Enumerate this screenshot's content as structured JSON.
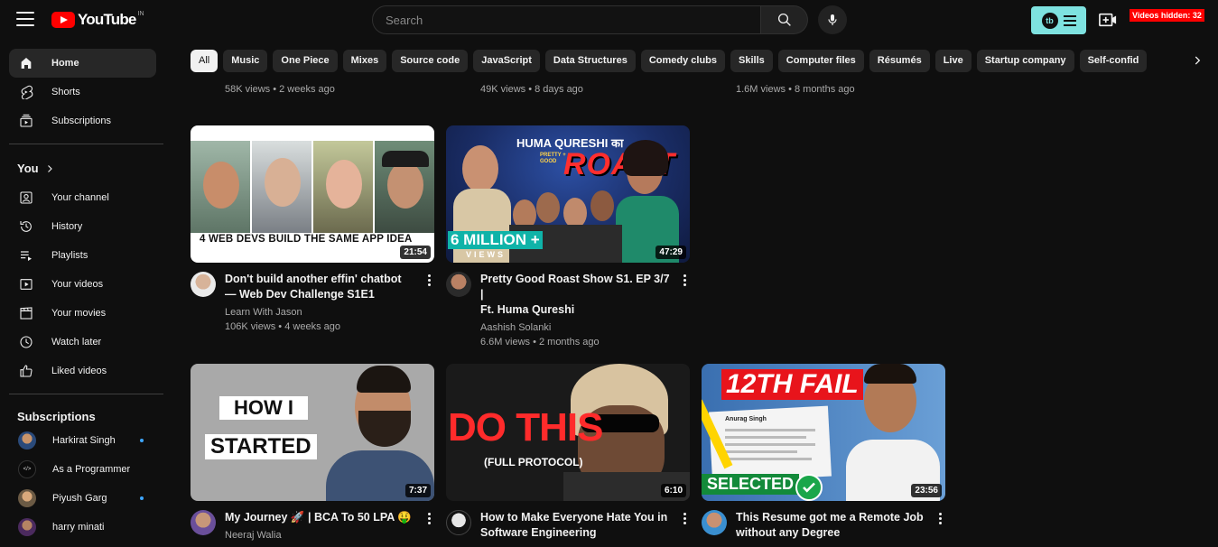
{
  "masthead": {
    "logo_text": "YouTube",
    "country": "IN",
    "search_placeholder": "Search",
    "hidden_badge": "Videos hidden: 32"
  },
  "sidebar": {
    "main": [
      {
        "label": "Home",
        "icon": "home-icon"
      },
      {
        "label": "Shorts",
        "icon": "shorts-icon"
      },
      {
        "label": "Subscriptions",
        "icon": "subscriptions-icon"
      }
    ],
    "you_heading": "You",
    "you": [
      {
        "label": "Your channel",
        "icon": "channel-icon"
      },
      {
        "label": "History",
        "icon": "history-icon"
      },
      {
        "label": "Playlists",
        "icon": "playlists-icon"
      },
      {
        "label": "Your videos",
        "icon": "your-videos-icon"
      },
      {
        "label": "Your movies",
        "icon": "movies-icon"
      },
      {
        "label": "Watch later",
        "icon": "watch-later-icon"
      },
      {
        "label": "Liked videos",
        "icon": "liked-icon"
      }
    ],
    "subs_heading": "Subscriptions",
    "subscriptions": [
      {
        "label": "Harkirat Singh",
        "new": true
      },
      {
        "label": "As a Programmer",
        "new": false
      },
      {
        "label": "Piyush Garg",
        "new": true
      },
      {
        "label": "harry minati",
        "new": false
      }
    ]
  },
  "chips": [
    "All",
    "Music",
    "One Piece",
    "Mixes",
    "Source code",
    "JavaScript",
    "Data Structures",
    "Comedy clubs",
    "Skills",
    "Computer files",
    "Résumés",
    "Live",
    "Startup company",
    "Self-confid"
  ],
  "prev_row": [
    "58K views • 2 weeks ago",
    "49K views • 8 days ago",
    "1.6M views • 8 months ago"
  ],
  "videos": [
    {
      "title_l1": "Don't build another effin' chatbot",
      "title_l2": "— Web Dev Challenge S1E1",
      "channel": "Learn With Jason",
      "stats": "106K views • 4 weeks ago",
      "duration": "21:54",
      "thumb_text": "4 WEB DEVS BUILD THE SAME APP IDEA"
    },
    {
      "title_l1": "Pretty Good Roast Show S1. EP 3/7 |",
      "title_l2": "Ft. Huma Qureshi",
      "channel": "Aashish Solanki",
      "stats": "6.6M views • 2 months ago",
      "duration": "47:29",
      "thumb_top": "HUMA QURESHI का",
      "thumb_small": "PRETTY + GOOD",
      "thumb_big": "ROAST",
      "thumb_million": "6 MILLION +",
      "thumb_views": "VIEWS"
    },
    {
      "title_l1": "My Journey 🚀 | BCA To 50 LPA 🤑",
      "channel": "Neeraj Walia",
      "duration": "7:37",
      "thumb_l1": "HOW I",
      "thumb_l2": "STARTED"
    },
    {
      "title_l1": "How to Make Everyone Hate You in",
      "title_l2": "Software Engineering",
      "duration": "6:10",
      "thumb_big": "DO THIS",
      "thumb_small": "(FULL PROTOCOL)"
    },
    {
      "title_l1": "This Resume got me a Remote Job",
      "title_l2": "without any Degree",
      "duration": "23:56",
      "thumb_top": "12TH FAIL",
      "thumb_bottom": "SELECTED",
      "thumb_name": "Anurag Singh"
    }
  ]
}
